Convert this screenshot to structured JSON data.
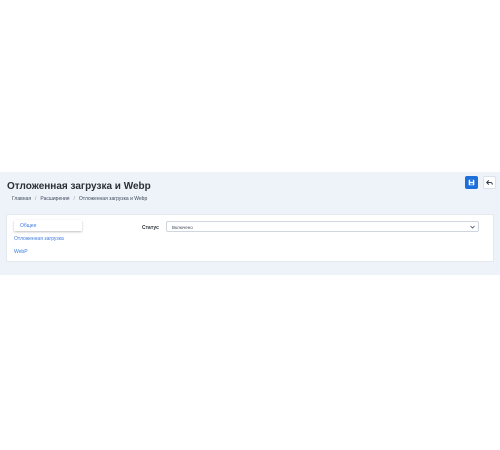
{
  "header": {
    "title": "Отложенная загрузка и Webp",
    "save_icon": "save-icon",
    "back_icon": "back-arrow-icon",
    "accent": "#1e6fd9"
  },
  "breadcrumb": {
    "items": [
      "Главная",
      "Расширения",
      "Отложенная загрузка и Webp"
    ]
  },
  "tabs": [
    {
      "label": "Общее",
      "active": true
    },
    {
      "label": "Отложенная загрузка",
      "active": false
    },
    {
      "label": "WebP",
      "active": false
    }
  ],
  "form": {
    "status_label": "Статус",
    "status_value": "Включено"
  }
}
